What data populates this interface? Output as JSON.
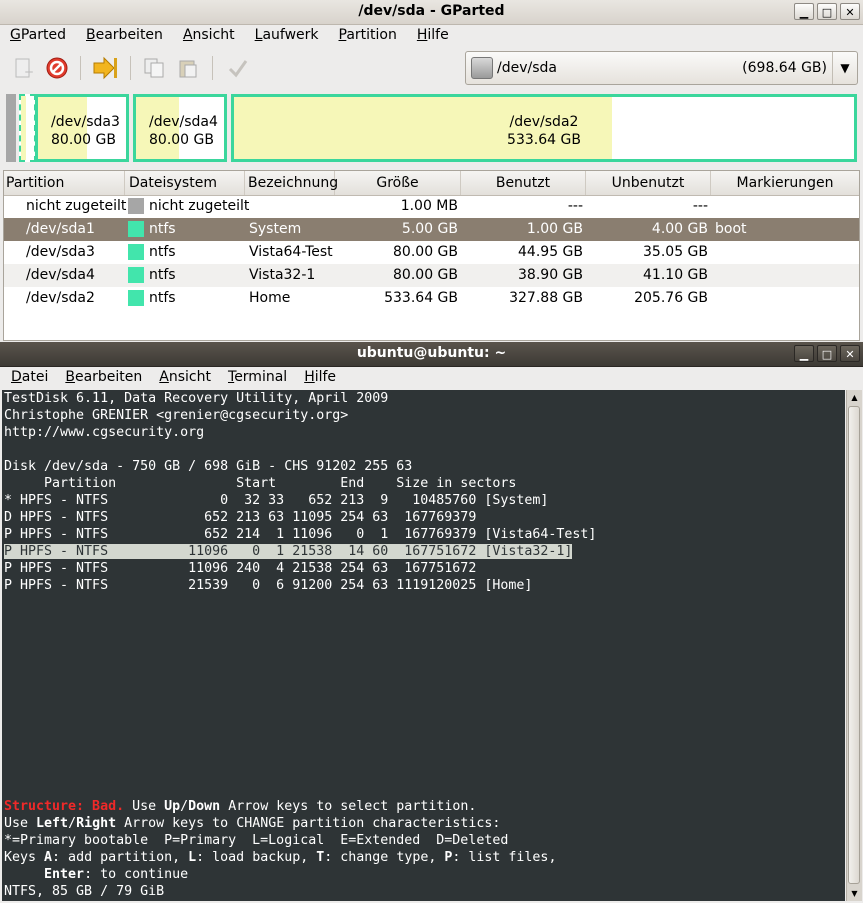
{
  "gparted": {
    "title": "/dev/sda - GParted",
    "menu": [
      "GParted",
      "Bearbeiten",
      "Ansicht",
      "Laufwerk",
      "Partition",
      "Hilfe"
    ],
    "device": {
      "name": "/dev/sda",
      "size": "(698.64 GB)"
    },
    "partbar": {
      "sda3": {
        "name": "/dev/sda3",
        "size": "80.00 GB",
        "used_fraction": 0.56
      },
      "sda4": {
        "name": "/dev/sda4",
        "size": "80.00 GB",
        "used_fraction": 0.49
      },
      "sda2": {
        "name": "/dev/sda2",
        "size": "533.64 GB",
        "used_fraction": 0.61
      }
    },
    "table": {
      "headers": [
        "Partition",
        "Dateisystem",
        "Bezeichnung",
        "Größe",
        "Benutzt",
        "Unbenutzt",
        "Markierungen"
      ],
      "rows": [
        {
          "partition": "nicht zugeteilt",
          "fs": "nicht zugeteilt",
          "label": "",
          "size": "1.00 MB",
          "used": "---",
          "unused": "---",
          "flags": "",
          "swatch": "#a6a6a6"
        },
        {
          "partition": "/dev/sda1",
          "fs": "ntfs",
          "label": "System",
          "size": "5.00 GB",
          "used": "1.00 GB",
          "unused": "4.00 GB",
          "flags": "boot",
          "swatch": "#42e5ac"
        },
        {
          "partition": "/dev/sda3",
          "fs": "ntfs",
          "label": "Vista64-Test",
          "size": "80.00 GB",
          "used": "44.95 GB",
          "unused": "35.05 GB",
          "flags": "",
          "swatch": "#42e5ac"
        },
        {
          "partition": "/dev/sda4",
          "fs": "ntfs",
          "label": "Vista32-1",
          "size": "80.00 GB",
          "used": "38.90 GB",
          "unused": "41.10 GB",
          "flags": "",
          "swatch": "#42e5ac"
        },
        {
          "partition": "/dev/sda2",
          "fs": "ntfs",
          "label": "Home",
          "size": "533.64 GB",
          "used": "327.88 GB",
          "unused": "205.76 GB",
          "flags": "",
          "swatch": "#42e5ac"
        }
      ]
    }
  },
  "terminal": {
    "title": "ubuntu@ubuntu: ~",
    "menu": [
      "Datei",
      "Bearbeiten",
      "Ansicht",
      "Terminal",
      "Hilfe"
    ],
    "lines": [
      "TestDisk 6.11, Data Recovery Utility, April 2009",
      "Christophe GRENIER <grenier@cgsecurity.org>",
      "http://www.cgsecurity.org",
      "",
      "Disk /dev/sda - 750 GB / 698 GiB - CHS 91202 255 63",
      "     Partition               Start        End    Size in sectors",
      "* HPFS - NTFS              0  32 33   652 213  9   10485760 [System]",
      "D HPFS - NTFS            652 213 63 11095 254 63  167769379",
      "P HPFS - NTFS            652 214  1 11096   0  1  167769379 [Vista64-Test]",
      "P HPFS - NTFS          11096   0  1 21538  14 60  167751672 [Vista32-1]",
      "P HPFS - NTFS          11096 240  4 21538 254 63  167751672",
      "P HPFS - NTFS          21539   0  6 91200 254 63 1119120025 [Home]"
    ],
    "help": {
      "l1_bad": "Structure: Bad.",
      "l1_a": " Use ",
      "l1_b": "Up",
      "l1_c": "/",
      "l1_d": "Down",
      "l1_e": " Arrow keys to select partition.",
      "l2_a": "Use ",
      "l2_b": "Left",
      "l2_c": "/",
      "l2_d": "Right",
      "l2_e": " Arrow keys to CHANGE partition characteristics:",
      "l3": "*=Primary bootable  P=Primary  L=Logical  E=Extended  D=Deleted",
      "l4_a": "Keys ",
      "l4_b": "A",
      "l4_c": ": add partition, ",
      "l4_d": "L",
      "l4_e": ": load backup, ",
      "l4_f": "T",
      "l4_g": ": change type, ",
      "l4_h": "P",
      "l4_i": ": list files,",
      "l5_a": "     ",
      "l5_b": "Enter",
      "l5_c": ": to continue",
      "l6": "NTFS, 85 GB / 79 GiB"
    }
  }
}
